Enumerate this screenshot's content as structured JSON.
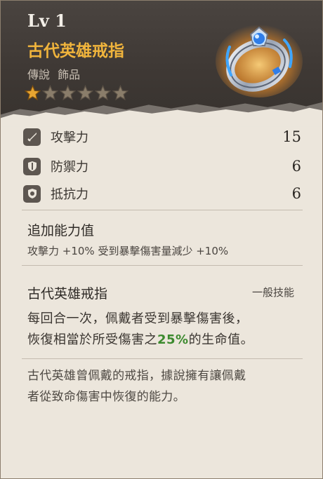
{
  "item": {
    "level": "Lv 1",
    "name": "古代英雄戒指",
    "rarity": "傳說",
    "category": "飾品",
    "stars_filled": 1,
    "stars_total": 6,
    "icon": "ring-icon"
  },
  "stats": [
    {
      "icon": "sword-icon",
      "label": "攻擊力",
      "value": "15"
    },
    {
      "icon": "shield-icon",
      "label": "防禦力",
      "value": "6"
    },
    {
      "icon": "resist-shield-icon",
      "label": "抵抗力",
      "value": "6"
    }
  ],
  "bonus": {
    "title": "追加能力值",
    "text": "攻擊力 +10% 受到暴擊傷害量減少 +10%"
  },
  "skill": {
    "name": "古代英雄戒指",
    "type": "一般技能",
    "desc_line1": "每回合一次，佩戴者受到暴擊傷害後，",
    "desc_line2_pre": "恢復相當於所受傷害之",
    "desc_line2_highlight": "25%",
    "desc_line2_post": "的生命值。"
  },
  "lore": {
    "line1": "古代英雄曾佩戴的戒指，據說擁有讓佩戴",
    "line2": "者從致命傷害中恢復的能力。"
  },
  "colors": {
    "name_gold": "#f0b43c",
    "highlight_green": "#3c8a2e",
    "header_dark": "#3f3935",
    "body_paper": "#ece6dc"
  }
}
